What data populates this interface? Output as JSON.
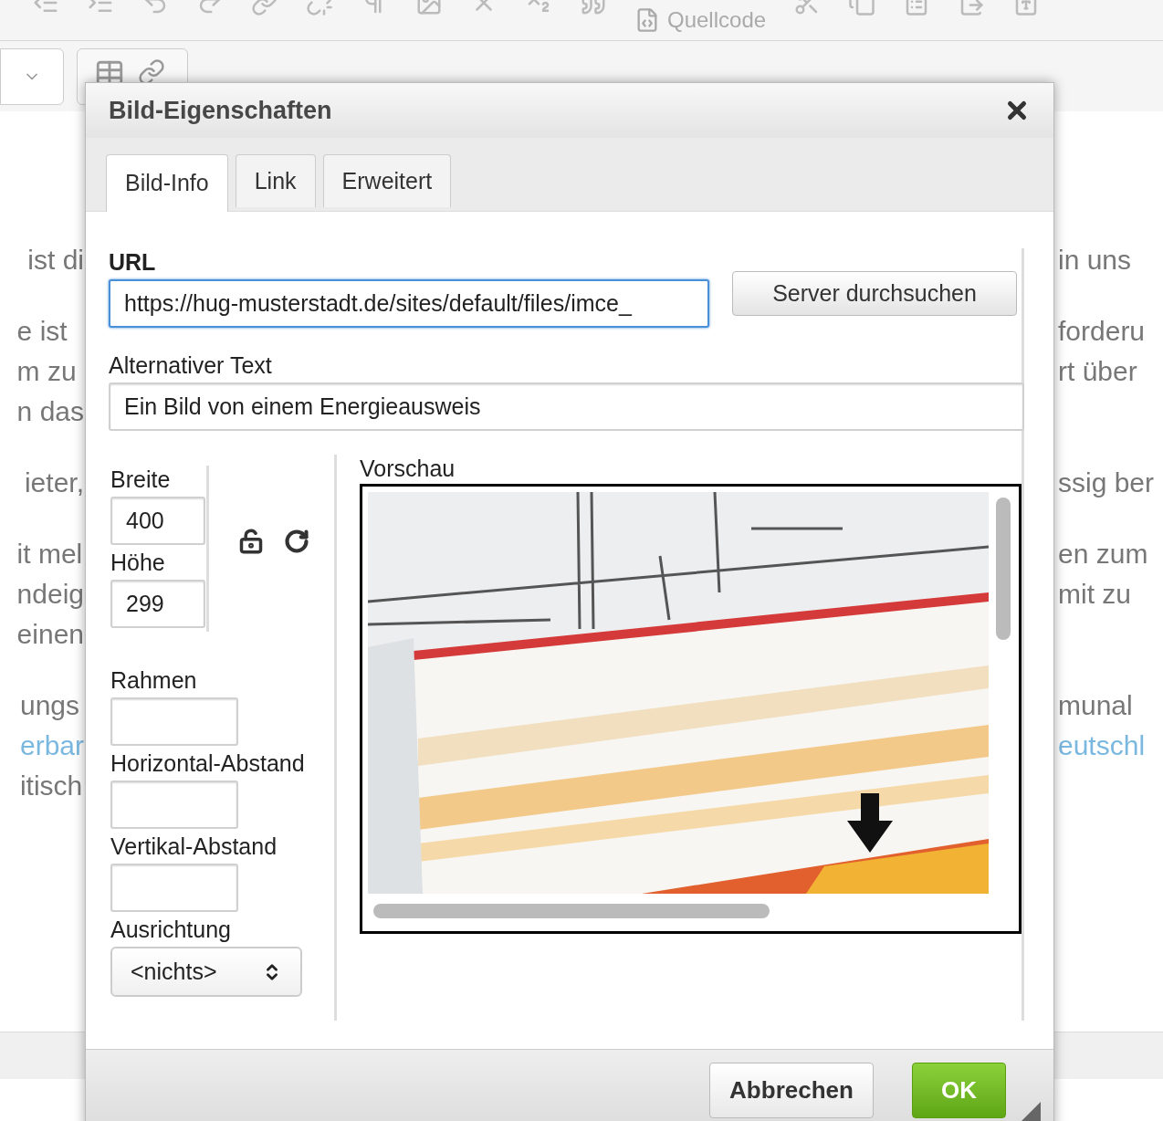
{
  "toolbar": {
    "source_label": "Quellcode"
  },
  "background_text": [
    {
      "lines": [
        {
          "left": {
            "text": "ist di",
            "link": false
          },
          "right": {
            "text": "in uns",
            "link": false
          }
        }
      ]
    },
    {
      "lines": [
        {
          "left": {
            "text": "e ist",
            "link": false
          },
          "right": {
            "text": "forderu",
            "link": false
          }
        },
        {
          "left": {
            "text": "m zu",
            "link": false
          },
          "right": {
            "text": "rt über",
            "link": false
          }
        },
        {
          "left": {
            "text": "n das",
            "link": false
          }
        }
      ]
    },
    {
      "lines": [
        {
          "left": {
            "text": "ieter,",
            "link": false
          },
          "right": {
            "text": "ssig ber",
            "link": false
          }
        }
      ]
    },
    {
      "lines": [
        {
          "left": {
            "text": "it mel",
            "link": false
          },
          "right": {
            "text": "en zum",
            "link": false
          }
        },
        {
          "left": {
            "text": "ndeig",
            "link": false
          },
          "right": {
            "text": "mit zu",
            "link": false
          }
        },
        {
          "left": {
            "text": "einen",
            "link": false
          }
        }
      ]
    },
    {
      "lines": [
        {
          "left": {
            "text": "ungs",
            "link": false
          },
          "right": {
            "text": "munal",
            "link": false
          }
        },
        {
          "left": {
            "text": "erbar",
            "link": true
          },
          "right": {
            "text": "eutschl",
            "link": true
          }
        },
        {
          "left": {
            "text": "itisch",
            "link": false
          }
        }
      ]
    }
  ],
  "dialog": {
    "title": "Bild-Eigenschaften",
    "tabs": [
      {
        "label": "Bild-Info",
        "selected": true
      },
      {
        "label": "Link",
        "selected": false
      },
      {
        "label": "Erweitert",
        "selected": false
      }
    ],
    "url": {
      "label": "URL",
      "value": "https://hug-musterstadt.de/sites/default/files/imce_",
      "focused": true
    },
    "browse_button": "Server durchsuchen",
    "alt_text": {
      "label": "Alternativer Text",
      "value": "Ein Bild von einem Energieausweis"
    },
    "width": {
      "label": "Breite",
      "value": "400"
    },
    "height": {
      "label": "Höhe",
      "value": "299"
    },
    "border": {
      "label": "Rahmen"
    },
    "hspace": {
      "label": "Horizontal-Abstand"
    },
    "vspace": {
      "label": "Vertikal-Abstand"
    },
    "align": {
      "label": "Ausrichtung",
      "value": "<nichts>"
    },
    "preview": {
      "label": "Vorschau"
    },
    "cancel_button": "Abbrechen",
    "ok_button": "OK"
  }
}
